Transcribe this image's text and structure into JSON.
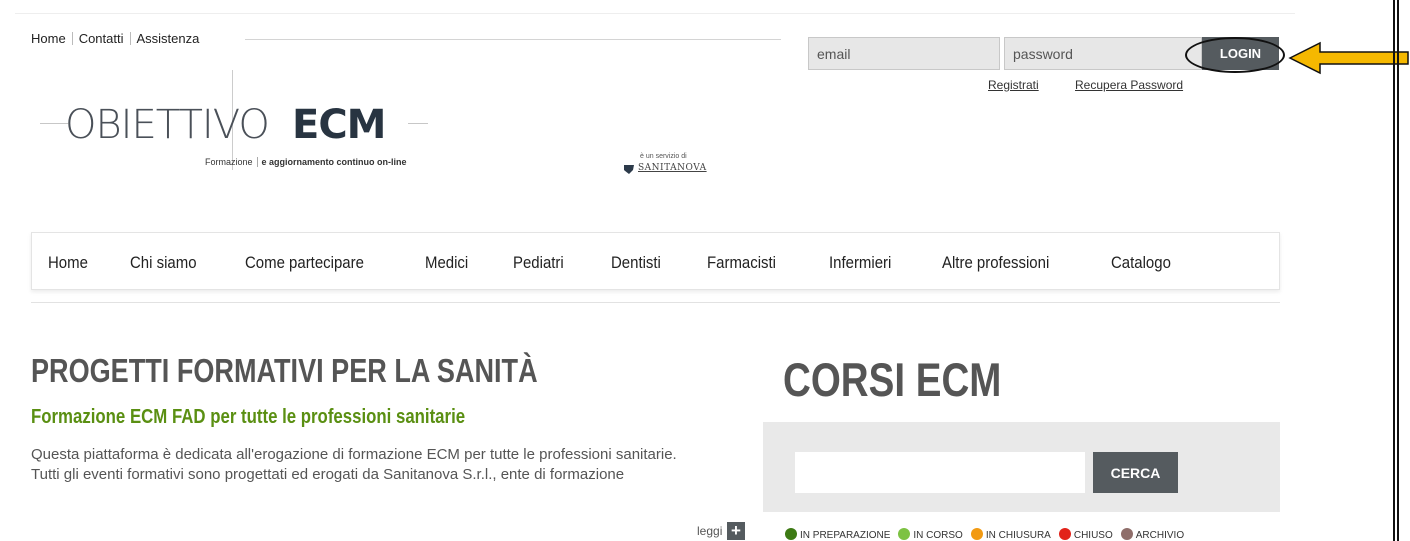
{
  "top_links": [
    "Home",
    "Contatti",
    "Assistenza"
  ],
  "login": {
    "email_placeholder": "email",
    "password_placeholder": "password",
    "button_label": "LOGIN",
    "register_label": "Registrati",
    "recover_label": "Recupera Password"
  },
  "logo": {
    "obiettivo": "OBIETTIVO",
    "ecm": "ECM",
    "tagline_left": "Formazione",
    "tagline_right": "e aggiornamento continuo on-line"
  },
  "partner": {
    "prefix": "è un servizio di",
    "name": "SANITANOVA"
  },
  "nav": [
    "Home",
    "Chi siamo",
    "Come partecipare",
    "Medici",
    "Pediatri",
    "Dentisti",
    "Farmacisti",
    "Infermieri",
    "Altre professioni",
    "Catalogo"
  ],
  "hero": {
    "title": "PROGETTI FORMATIVI PER LA SANITÀ",
    "subtitle": "Formazione ECM FAD per tutte le professioni sanitarie",
    "body_line1": "Questa piattaforma è dedicata all'erogazione di formazione ECM per tutte le professioni sanitarie.",
    "body_line2": "Tutti gli eventi formativi sono progettati ed erogati da Sanitanova S.r.l., ente di formazione",
    "read_more": "leggi",
    "read_more_icon": "+"
  },
  "corsi": {
    "title": "CORSI ECM",
    "search_placeholder": "",
    "search_button": "CERCA"
  },
  "legend": [
    {
      "label": "IN PREPARAZIONE",
      "color": "#3d7a14"
    },
    {
      "label": "IN CORSO",
      "color": "#7dc243"
    },
    {
      "label": "IN CHIUSURA",
      "color": "#f29a12"
    },
    {
      "label": "CHIUSO",
      "color": "#e2231a"
    },
    {
      "label": "ARCHIVIO",
      "color": "#8f6e6a"
    }
  ],
  "annotation": {
    "arrow_color": "#f5b800",
    "ring_color": "#111111"
  }
}
